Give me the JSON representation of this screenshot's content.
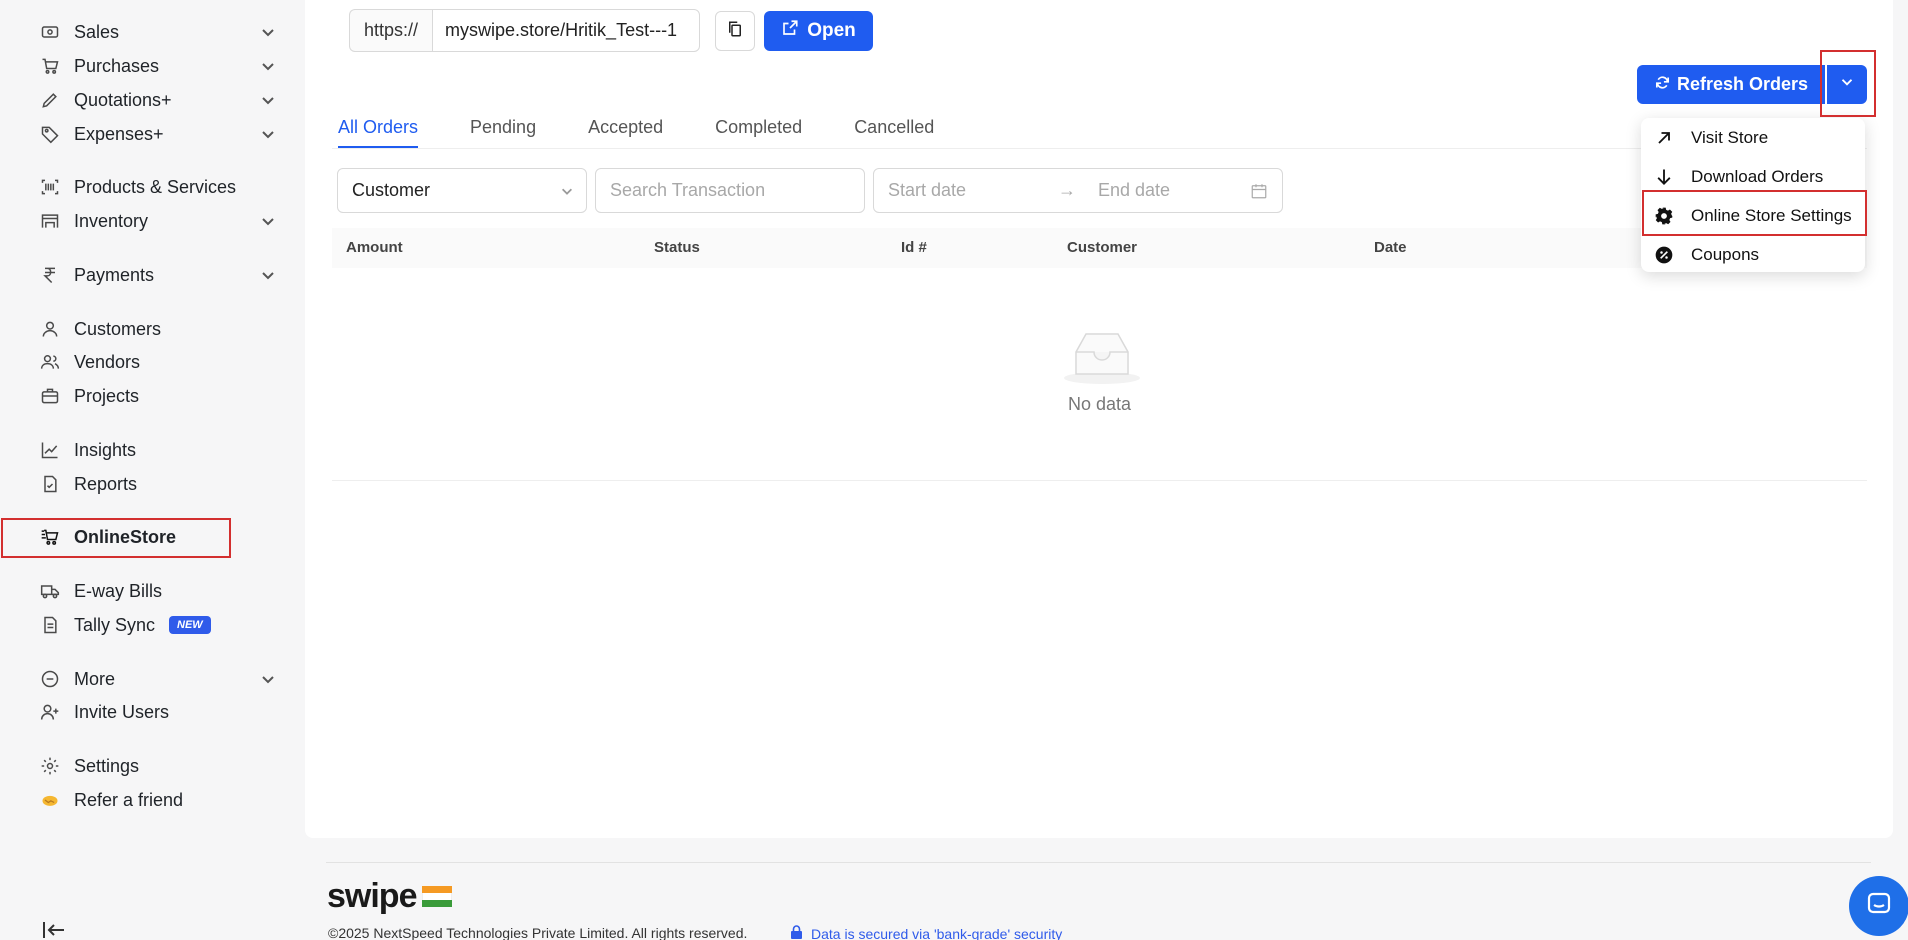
{
  "sidebar": {
    "items": [
      {
        "label": "Sales",
        "icon": "cash-icon"
      },
      {
        "label": "Purchases",
        "icon": "cart-icon"
      },
      {
        "label": "Quotations+",
        "icon": "pencil-icon"
      },
      {
        "label": "Expenses+",
        "icon": "tag-icon"
      },
      {
        "label": "Products & Services",
        "icon": "barcode-icon"
      },
      {
        "label": "Inventory",
        "icon": "warehouse-icon"
      },
      {
        "label": "Payments",
        "icon": "rupee-icon"
      },
      {
        "label": "Customers",
        "icon": "user-icon"
      },
      {
        "label": "Vendors",
        "icon": "users-icon"
      },
      {
        "label": "Projects",
        "icon": "briefcase-icon"
      },
      {
        "label": "Insights",
        "icon": "chart-line-icon"
      },
      {
        "label": "Reports",
        "icon": "report-icon"
      },
      {
        "label": "OnlineStore",
        "icon": "store-cart-icon"
      },
      {
        "label": "E-way Bills",
        "icon": "truck-icon"
      },
      {
        "label": "Tally Sync",
        "icon": "document-icon",
        "badge": "NEW"
      },
      {
        "label": "More",
        "icon": "more-circle-icon"
      },
      {
        "label": "Invite Users",
        "icon": "user-plus-icon"
      },
      {
        "label": "Settings",
        "icon": "gear-icon"
      },
      {
        "label": "Refer a friend",
        "icon": "handshake-icon"
      }
    ]
  },
  "store_link": {
    "prefix": "https://",
    "value": "myswipe.store/Hritik_Test---1",
    "open_label": "Open"
  },
  "refresh": {
    "label": "Refresh Orders"
  },
  "tabs": [
    "All Orders",
    "Pending",
    "Accepted",
    "Completed",
    "Cancelled"
  ],
  "filters": {
    "customer_select": "Customer",
    "search_placeholder": "Search Transaction",
    "start_date": "Start date",
    "end_date": "End date",
    "range_arrow": "→"
  },
  "table": {
    "columns": [
      "Amount",
      "Status",
      "Id #",
      "Customer",
      "Date"
    ],
    "empty_text": "No data"
  },
  "menu": {
    "items": [
      {
        "label": "Visit Store",
        "icon": "arrow-up-right-icon"
      },
      {
        "label": "Download Orders",
        "icon": "arrow-down-icon"
      },
      {
        "label": "Online Store Settings",
        "icon": "gear-icon"
      },
      {
        "label": "Coupons",
        "icon": "coupon-icon"
      }
    ]
  },
  "footer": {
    "logo": "swipe",
    "copyright": "©2025 NextSpeed Technologies Private Limited. All rights reserved.",
    "secure": "Data is secured via 'bank-grade' security"
  },
  "colors": {
    "accent": "#1f5cf0",
    "highlight": "#d32f2f"
  }
}
